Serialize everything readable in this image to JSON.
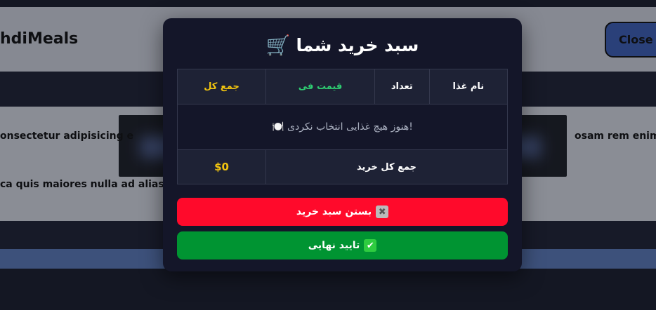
{
  "background": {
    "brand": "hdiMeals",
    "close_button": "Close C",
    "text_line1_left": "onsectetur adipisicing e",
    "text_line1_right": "osam rem enim q",
    "text_line2": "ca quis maiores nulla ad alias."
  },
  "modal": {
    "title": "سبد خرید شما",
    "cart_icon": "cart-icon",
    "table": {
      "headers": [
        "نام غذا",
        "تعداد",
        "قیمت فی",
        "جمع کل"
      ],
      "empty_message": "!هنوز هیچ غذایی انتخاب نکردی 🍽️",
      "footer_label": "جمع کل خرید",
      "footer_value": "$0"
    },
    "close_button": "بستن سبد خرید",
    "confirm_button": "تایید نهایی"
  },
  "colors": {
    "modal_bg": "#141629",
    "price_header": "#2ecc71",
    "total_header": "#f1c40f",
    "close_button": "#ff0a2b",
    "confirm_button": "#009432"
  }
}
